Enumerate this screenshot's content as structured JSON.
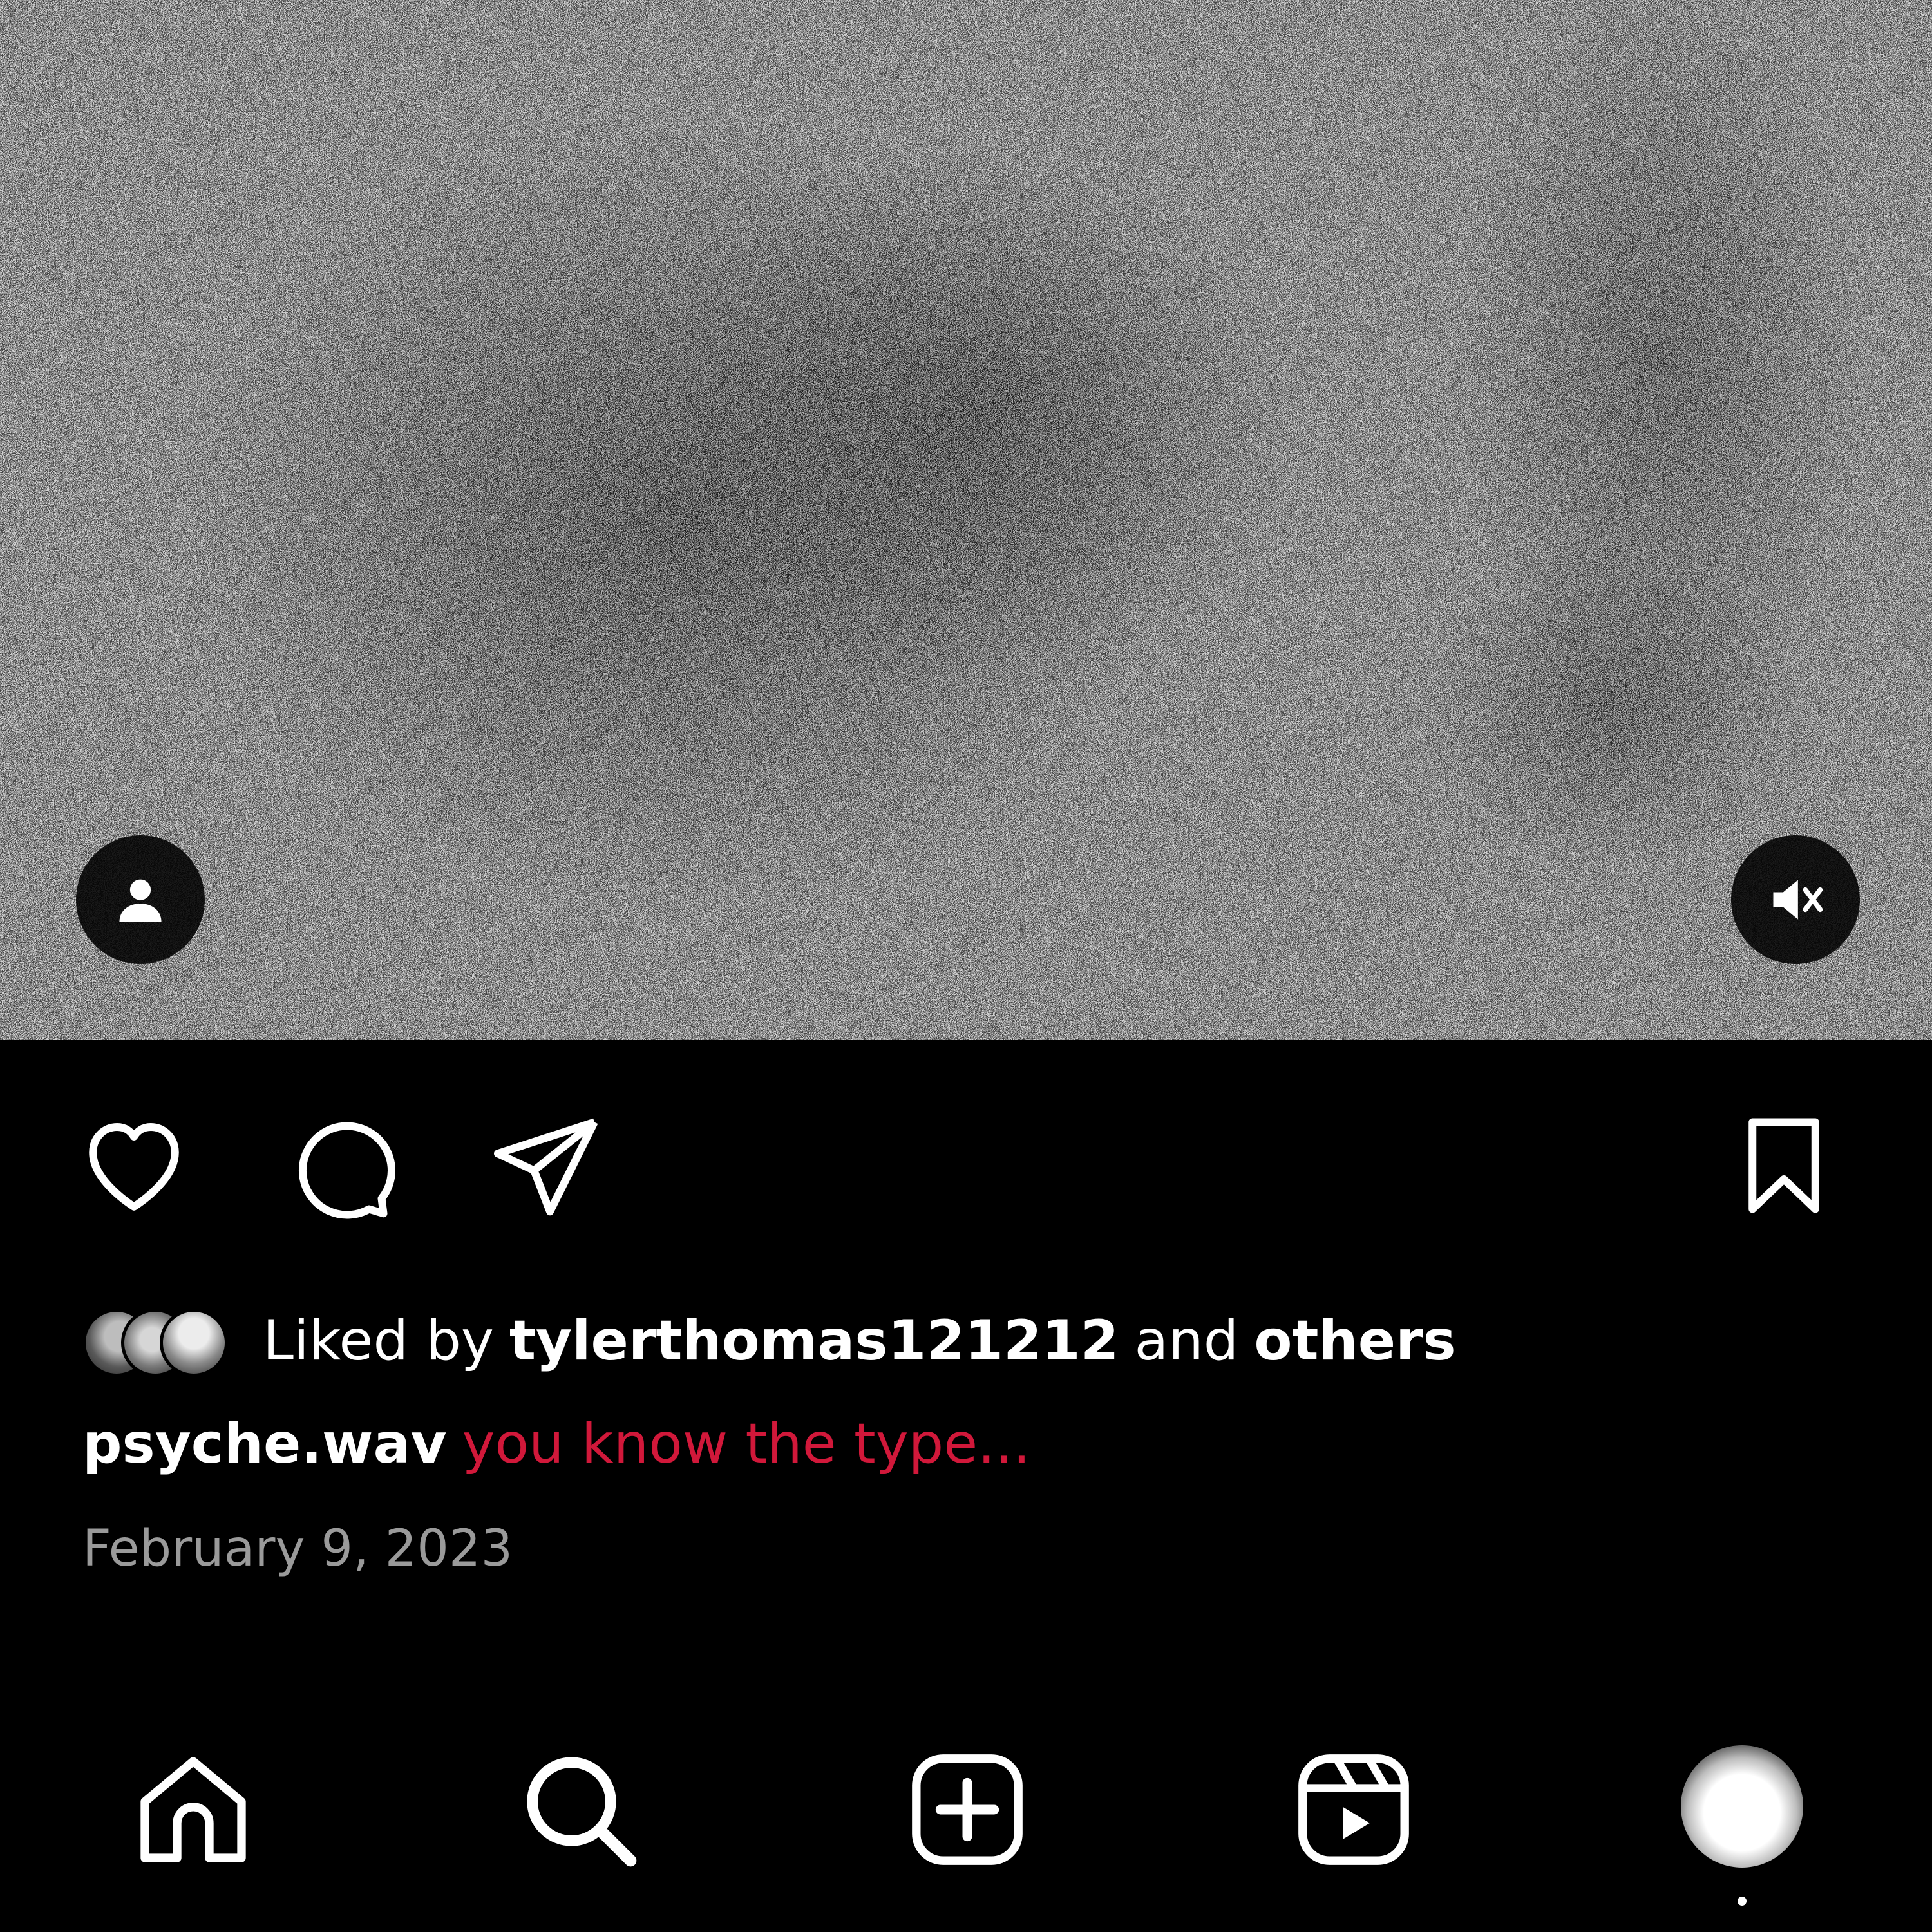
{
  "post": {
    "media": {
      "overlay_left_icon": "tagged-people-icon",
      "overlay_right_icon": "muted-audio-icon"
    },
    "actions": {
      "like_icon": "heart-icon",
      "comment_icon": "comment-icon",
      "share_icon": "paper-plane-icon",
      "save_icon": "bookmark-icon"
    },
    "likes": {
      "prefix": "Liked by",
      "top_liker": "tylerthomas121212",
      "joiner": "and",
      "others": "others"
    },
    "caption": {
      "username": "psyche.wav",
      "text": "you know the type..."
    },
    "date": "February 9, 2023"
  },
  "bottom_nav": {
    "items": [
      {
        "icon": "home-icon"
      },
      {
        "icon": "search-icon"
      },
      {
        "icon": "create-post-icon"
      },
      {
        "icon": "reels-icon"
      },
      {
        "icon": "profile-avatar"
      }
    ]
  },
  "colors": {
    "background": "#000000",
    "text": "#ffffff",
    "caption_accent": "#d1183a",
    "date": "#9a9a9a"
  }
}
